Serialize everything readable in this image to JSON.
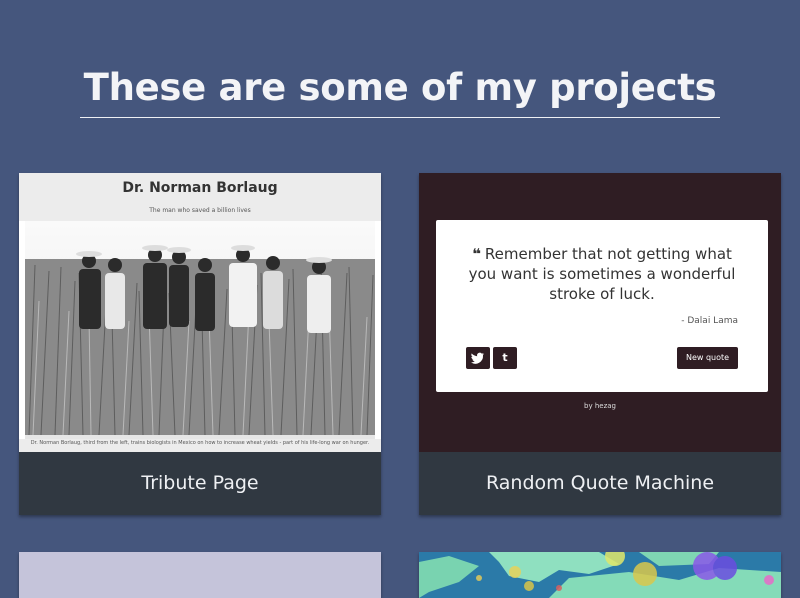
{
  "header": {
    "title": "These are some of my projects"
  },
  "projects": [
    {
      "title": "Tribute Page",
      "thumbnail": {
        "heading": "Dr. Norman Borlaug",
        "subtitle": "The man who saved a billion lives",
        "caption": "Dr. Norman Borlaug, third from the left, trains biologists in Mexico on how to increase wheat yields - part of his life-long war on hunger."
      }
    },
    {
      "title": "Random Quote Machine",
      "thumbnail": {
        "quote_mark": "❝",
        "quote": "Remember that not getting what you want is sometimes a wonderful stroke of luck.",
        "author": "- Dalai Lama",
        "twitter_label": "t",
        "tumblr_label": "t",
        "new_quote_label": "New quote",
        "byline": "by hezag"
      }
    },
    {
      "title": ""
    },
    {
      "title": ""
    }
  ],
  "colors": {
    "background": "#45567d",
    "card_footer": "#303841",
    "quote_bg": "#2f1d23"
  }
}
